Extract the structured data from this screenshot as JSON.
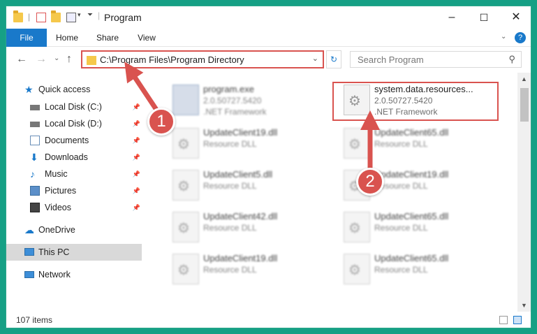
{
  "window": {
    "title": "Program",
    "minimize_glyph": "–",
    "maximize_glyph": "☐",
    "close_glyph": "✕"
  },
  "ribbon": {
    "tabs": [
      "File",
      "Home",
      "Share",
      "View"
    ],
    "help_glyph": "?"
  },
  "address": {
    "path": "C:\\Program Files\\Program Directory"
  },
  "search": {
    "placeholder": "Search Program"
  },
  "sidebar": {
    "items": [
      {
        "label": "Quick access",
        "icon": "star-icon",
        "pinned": false
      },
      {
        "label": "Local Disk (C:)",
        "icon": "drive-icon",
        "pinned": true
      },
      {
        "label": "Local Disk (D:)",
        "icon": "drive-icon",
        "pinned": true
      },
      {
        "label": "Documents",
        "icon": "documents-icon",
        "pinned": true
      },
      {
        "label": "Downloads",
        "icon": "download-arrow-icon",
        "pinned": true
      },
      {
        "label": "Music",
        "icon": "music-note-icon",
        "pinned": true
      },
      {
        "label": "Pictures",
        "icon": "pictures-icon",
        "pinned": true
      },
      {
        "label": "Videos",
        "icon": "film-icon",
        "pinned": true
      },
      {
        "label": "OneDrive",
        "icon": "cloud-icon",
        "pinned": false
      },
      {
        "label": "This PC",
        "icon": "monitor-icon",
        "pinned": false,
        "selected": true
      },
      {
        "label": "Network",
        "icon": "network-icon",
        "pinned": false
      }
    ]
  },
  "files": [
    {
      "name": "program.exe",
      "line2": "2.0.50727.5420",
      "line3": ".NET Framework",
      "blurred": true
    },
    {
      "name": "system.data.resources...",
      "line2": "2.0.50727.5420",
      "line3": ".NET Framework",
      "blurred": false,
      "highlighted": true
    },
    {
      "name": "UpdateClient19.dll",
      "line2": "Resource DLL",
      "blurred": true
    },
    {
      "name": "UpdateClient65.dll",
      "line2": "Resource DLL",
      "blurred": true
    },
    {
      "name": "UpdateClient5.dll",
      "line2": "Resource DLL",
      "blurred": true
    },
    {
      "name": "UpdateClient19.dll",
      "line2": "Resource DLL",
      "blurred": true
    },
    {
      "name": "UpdateClient42.dll",
      "line2": "Resource DLL",
      "blurred": true
    },
    {
      "name": "UpdateClient65.dll",
      "line2": "Resource DLL",
      "blurred": true
    },
    {
      "name": "UpdateClient19.dll",
      "line2": "Resource DLL",
      "blurred": true
    },
    {
      "name": "UpdateClient65.dll",
      "line2": "Resource DLL",
      "blurred": true
    }
  ],
  "status": {
    "item_count": "107 items"
  },
  "callouts": [
    "1",
    "2"
  ],
  "colors": {
    "accent": "#1979ca",
    "callout": "#d9534f",
    "background": "#16a085"
  }
}
